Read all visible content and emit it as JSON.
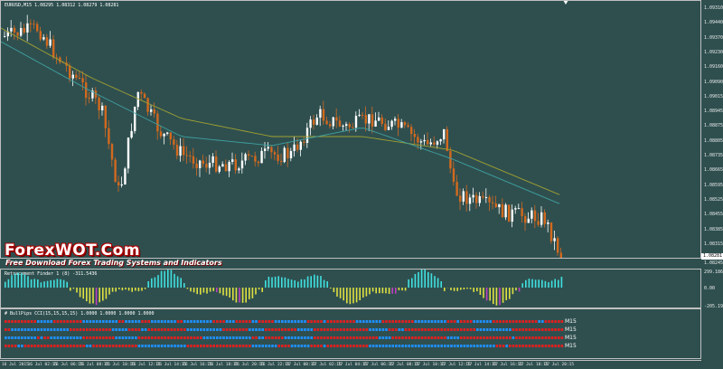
{
  "main_title": "EURUSD,M15  1.08295 1.08312 1.08279 1.08281",
  "price_tag": "1.08281",
  "price_axis": [
    "1.09310",
    "1.09440",
    "1.09370",
    "1.09230",
    "1.09160",
    "1.09090",
    "1.09015",
    "1.08945",
    "1.08875",
    "1.08805",
    "1.08735",
    "1.08665",
    "1.08595",
    "1.08525",
    "1.08455",
    "1.08385",
    "1.08315"
  ],
  "brand": "ForexWOT.Com",
  "tagline": "Free Download Forex Trading Systems and Indicators",
  "ret_title": "Retracement Finder 1 (8) -311.5436",
  "ret_axis": [
    "1.08245",
    "299.1868",
    "0.00",
    "-205.1925"
  ],
  "bull_title": "# BullPips CCI(15,15,15,15) 1.0000 1.0000 1.0000 1.0000",
  "bull_rows": [
    "M15",
    "M15",
    "M15",
    "M15"
  ],
  "time_axis": [
    "16 Jul 2015",
    "16 Jul 02:15",
    "16 Jul 06:15",
    "16 Jul 08:15",
    "16 Jul 10:15",
    "16 Jul 12:15",
    "16 Jul 14:15",
    "16 Jul 16:15",
    "16 Jul 18:15",
    "16 Jul 20:15",
    "16 Jul 22:15",
    "17 Jul 00:15",
    "17 Jul 02:15",
    "17 Jul 04:15",
    "17 Jul 06:15",
    "17 Jul 08:15",
    "17 Jul 10:15",
    "17 Jul 12:15",
    "17 Jul 14:15",
    "17 Jul 16:15",
    "17 Jul 18:15",
    "17 Jul 20:15"
  ],
  "colors": {
    "background": "#2f4f4f",
    "bull_candle": "#ffffff",
    "bear_candle": "#d2691e",
    "ma_slow": "#a0a030",
    "ma_fast": "#3fa0a0",
    "hist_up": "#40e0e0",
    "hist_down": "#e0e040",
    "hist_mid": "#c040c0",
    "dot_red": "#e02020",
    "dot_blue": "#1e90ff"
  }
}
